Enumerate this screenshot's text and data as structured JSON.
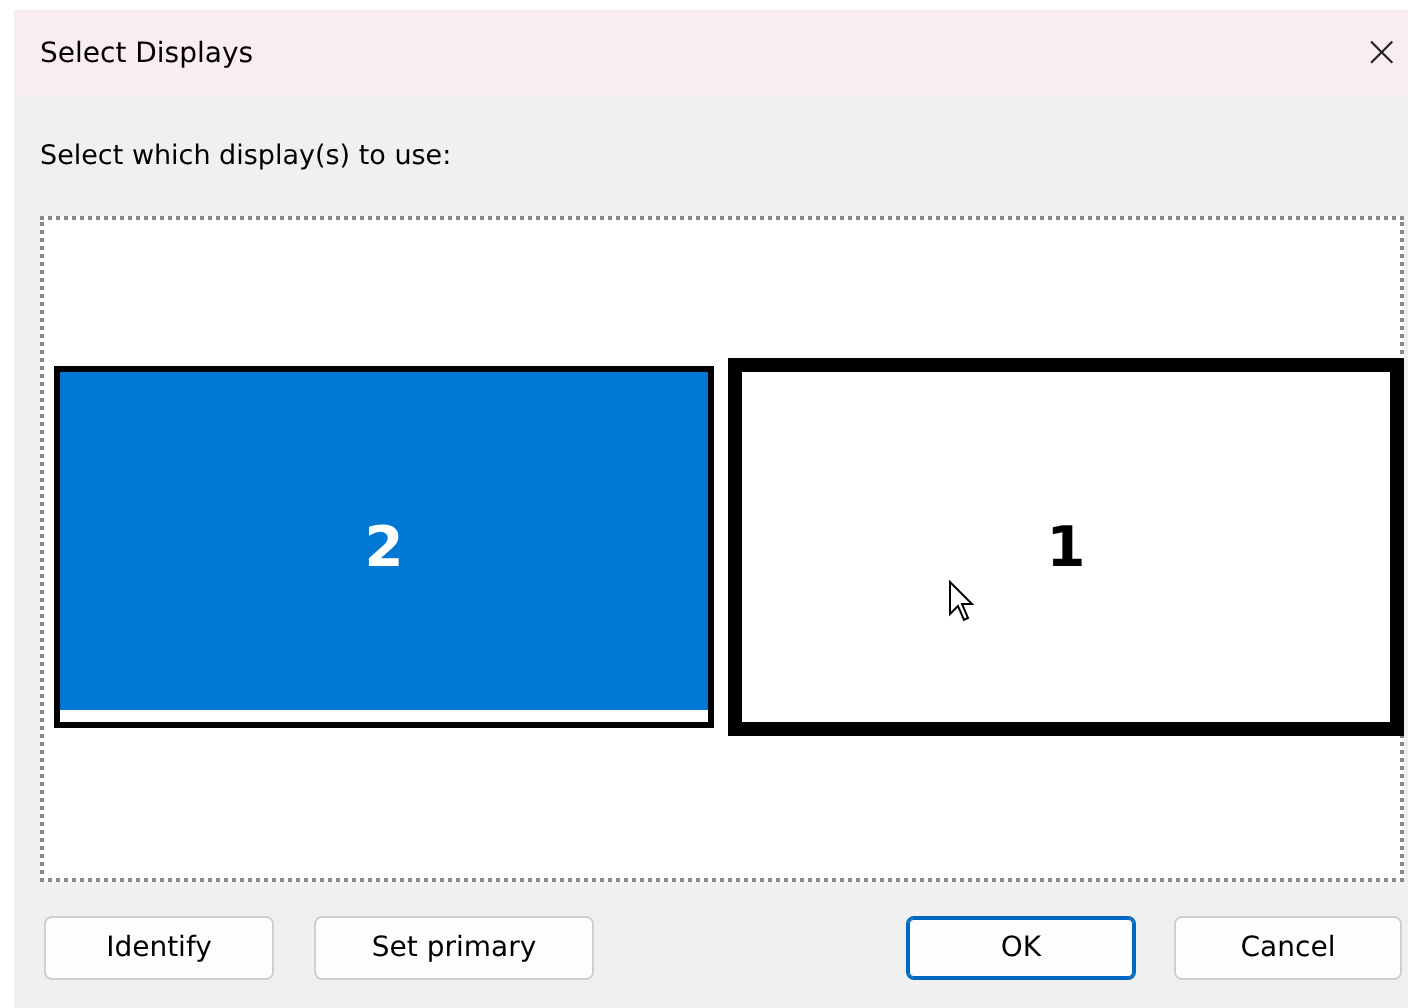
{
  "window": {
    "title": "Select Displays",
    "close": "×"
  },
  "prompt": "Select which display(s) to use:",
  "displays": [
    {
      "label": "2",
      "selected": true
    },
    {
      "label": "1",
      "selected": false
    }
  ],
  "buttons": [
    {
      "label": "Identify",
      "default": false
    },
    {
      "label": "Set primary",
      "default": false
    },
    {
      "label": "OK",
      "default": true
    },
    {
      "label": "Cancel",
      "default": false
    }
  ]
}
